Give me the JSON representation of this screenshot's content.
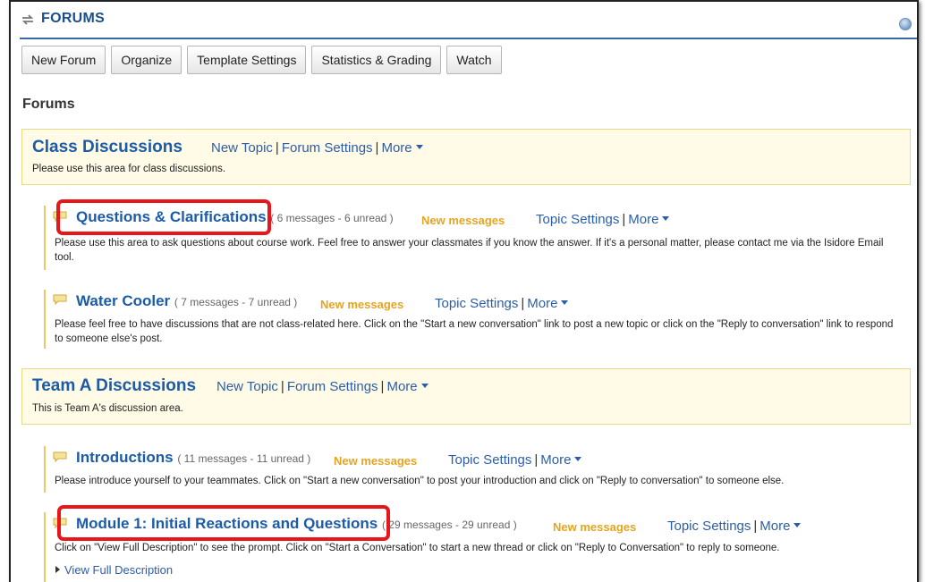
{
  "header": {
    "title": "FORUMS",
    "title_icon": "sync-arrows-icon",
    "help_icon": "help-icon"
  },
  "toolbar": {
    "buttons": [
      "New Forum",
      "Organize",
      "Template Settings",
      "Statistics & Grading",
      "Watch"
    ]
  },
  "section_heading": "Forums",
  "colors": {
    "link": "#2c5ea8",
    "title": "#1b5ba8",
    "new_messages": "#e7a41f",
    "forum_bg": "#fffbe6",
    "highlight": "#e8161b"
  },
  "forums": [
    {
      "title": "Class Discussions",
      "links": [
        "New Topic",
        "Forum Settings",
        "More"
      ],
      "description": "Please use this area for class discussions.",
      "topics": [
        {
          "title": "Questions & Clarifications",
          "count": "( 6 messages - 6 unread )",
          "new_label": "New messages",
          "links": [
            "Topic Settings",
            "More"
          ],
          "description": "Please use this area to ask questions about course work. Feel free to answer your classmates if you know the answer. If it's a personal matter, please contact me via the Isidore Email tool."
        },
        {
          "title": "Water Cooler",
          "count": "( 7 messages - 7 unread )",
          "new_label": "New messages",
          "links": [
            "Topic Settings",
            "More"
          ],
          "description": "Please feel free to have discussions that are not class-related here. Click on the \"Start a new conversation\" link to post a new topic or click on the \"Reply to conversation\" link to respond to someone else's post."
        }
      ]
    },
    {
      "title": "Team A Discussions",
      "links": [
        "New Topic",
        "Forum Settings",
        "More"
      ],
      "description": "This is Team A's discussion area.",
      "topics": [
        {
          "title": "Introductions",
          "count": "( 11 messages - 11 unread )",
          "new_label": "New messages",
          "links": [
            "Topic Settings",
            "More"
          ],
          "description": "Please introduce yourself to your teammates. Click on \"Start a new conversation\" to post your introduction and click on \"Reply to conversation\" to someone else."
        },
        {
          "title": "Module 1: Initial Reactions and Questions",
          "count": "( 29 messages - 29 unread )",
          "new_label": "New messages",
          "links": [
            "Topic Settings",
            "More"
          ],
          "description": "Click on \"View Full Description\" to see the prompt. Click on \"Start a Conversation\" to start a new thread or click on \"Reply to Conversation\" to reply to someone.",
          "extra_link": "View Full Description"
        }
      ]
    }
  ]
}
